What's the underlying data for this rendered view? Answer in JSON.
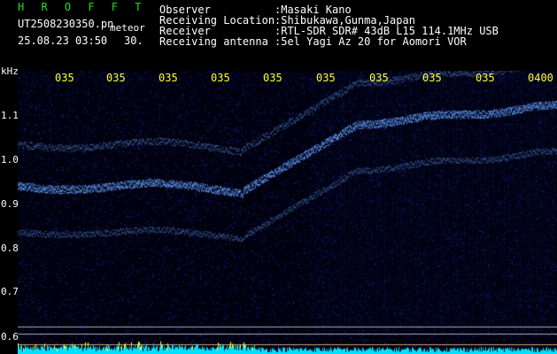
{
  "header": {
    "app_title": "H R O F F T",
    "file_name": "UT2508230350.pn",
    "file_suffix": "meteor",
    "date_time": "25.08.23 03:50",
    "seconds": "30.",
    "fields": [
      {
        "label": "Observer",
        "value": ":Masaki Kano"
      },
      {
        "label": "Receiving Location",
        "value": ":Shibukawa,Gunma,Japan"
      },
      {
        "label": "Receiver",
        "value": ":RTL-SDR SDR# 43dB L15 114.1MHz USB"
      },
      {
        "label": "Receiving antenna",
        "value": ":5el Yagi Az 20 for Aomori VOR"
      }
    ]
  },
  "axis": {
    "unit": "kHz",
    "freq_labels": [
      "1.1",
      "1.0",
      "0.9",
      "0.8",
      "0.7",
      "0.6"
    ],
    "time_labels": [
      "035",
      "035",
      "035",
      "035",
      "035",
      "035",
      "035",
      "035",
      "035",
      "0400"
    ]
  },
  "colors": {
    "header_green": "#22dd22",
    "label_white": "#ffffff",
    "tick_yellow": "#ffff33",
    "signal_cyan": "#33ccff"
  }
}
